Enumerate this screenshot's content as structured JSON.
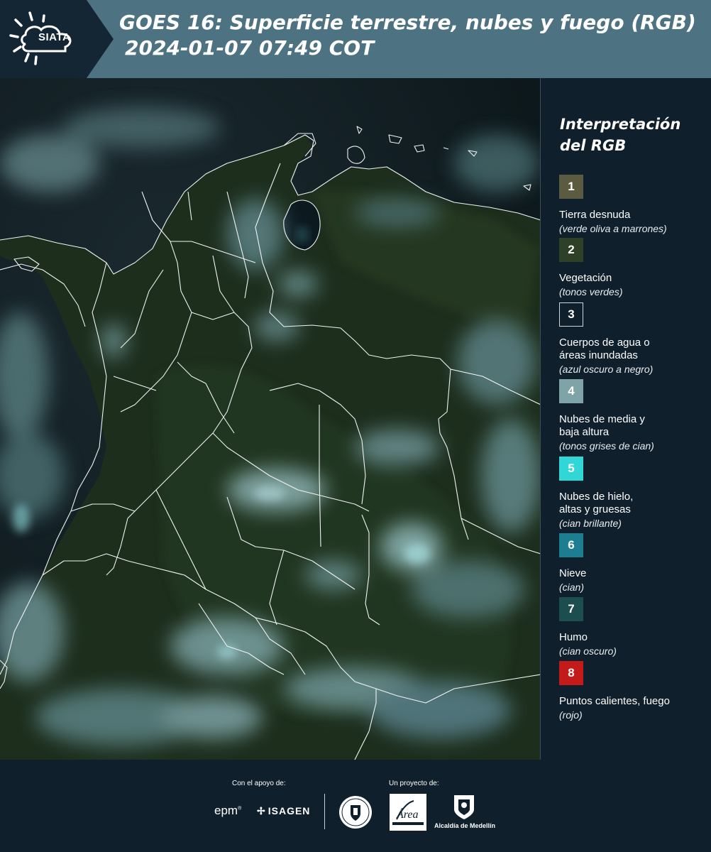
{
  "header": {
    "logo_text": "SIATA",
    "title_line1": "GOES 16: Superficie terrestre, nubes y fuego (RGB)",
    "title_line2": "2024-01-07 07:49 COT"
  },
  "legend": {
    "title": "Interpretación del RGB",
    "items": [
      {
        "number": "1",
        "name": "Tierra desnuda",
        "desc": "(verde oliva a marrones)",
        "color": "#5a5b40"
      },
      {
        "number": "2",
        "name": "Vegetación",
        "desc": "(tonos verdes)",
        "color": "#2e4127"
      },
      {
        "number": "3",
        "name": "Cuerpos de agua o\náreas inundadas",
        "desc": "(azul oscuro a negro)",
        "color": "#0f1f2c"
      },
      {
        "number": "4",
        "name": "Nubes de media y\nbaja altura",
        "desc": "(tonos grises de cian)",
        "color": "#7fa4a7"
      },
      {
        "number": "5",
        "name": "Nubes de hielo,\naltas y gruesas",
        "desc": "(cian brillante)",
        "color": "#31d6d6"
      },
      {
        "number": "6",
        "name": "Nieve",
        "desc": "(cian)",
        "color": "#1d7e92"
      },
      {
        "number": "7",
        "name": "Humo",
        "desc": "(cian oscuro)",
        "color": "#1c4e50"
      },
      {
        "number": "8",
        "name": "Puntos calientes, fuego",
        "desc": "(rojo)",
        "color": "#c41a1a"
      }
    ]
  },
  "footer": {
    "support_label": "Con el apoyo de:",
    "project_label": "Un proyecto de:",
    "epm": "epm",
    "isagen": "ISAGEN",
    "alcaldia": "Alcaldía de Medellín",
    "area_metropolitana": "Área"
  }
}
